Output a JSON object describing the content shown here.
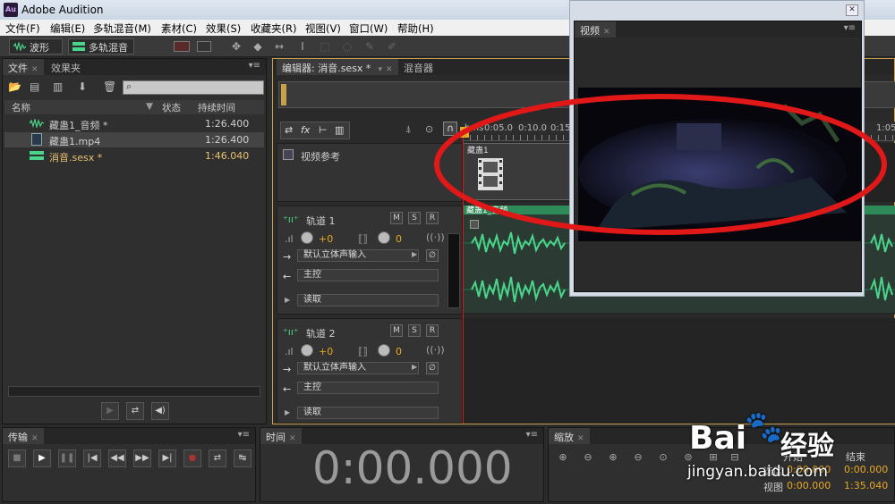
{
  "window": {
    "title": "Adobe Audition",
    "logo": "Au"
  },
  "menu": [
    "文件(F)",
    "编辑(E)",
    "多轨混音(M)",
    "素材(C)",
    "效果(S)",
    "收藏夹(R)",
    "视图(V)",
    "窗口(W)",
    "帮助(H)"
  ],
  "toolbar": {
    "waveform_label": "波形",
    "multitrack_label": "多轨混音"
  },
  "files_panel": {
    "tabs": [
      "文件",
      "效果夹"
    ],
    "columns": {
      "name": "名称",
      "status": "状态",
      "duration": "持续时间"
    },
    "rows": [
      {
        "name": "藏蛊1_音频 *",
        "duration": "1:26.400",
        "icon": "waveform-icon",
        "color": "#4ad68a"
      },
      {
        "name": "藏蛊1.mp4",
        "duration": "1:26.400",
        "icon": "film-icon",
        "color": "#cfcfcf"
      },
      {
        "name": "消音.sesx *",
        "duration": "1:46.040",
        "icon": "session-icon",
        "color": "#e8c070"
      }
    ]
  },
  "editor": {
    "tabs": [
      "编辑器: 消音.sesx *",
      "混音器"
    ],
    "ruler": {
      "unit": "hms",
      "labels": [
        "0:05.0",
        "0:10.0",
        "0:15.",
        "1:05"
      ]
    },
    "video_track": {
      "label": "视频参考",
      "clip_label": "藏蛊1"
    },
    "tracks": [
      {
        "name": "轨道 1",
        "volume": "+0",
        "pan": "0",
        "input": "默认立体声输入",
        "output": "主控",
        "mode": "读取",
        "clip_label": "藏蛊1_音频"
      },
      {
        "name": "轨道 2",
        "volume": "+0",
        "pan": "0",
        "input": "默认立体声输入",
        "output": "主控",
        "mode": "读取"
      }
    ],
    "track_buttons": [
      "M",
      "S",
      "R"
    ]
  },
  "video_panel": {
    "tab": "视频"
  },
  "transport": {
    "tab": "传输"
  },
  "time_panel": {
    "tab": "时间",
    "value": "0:00.000"
  },
  "zoom_panel": {
    "tab": "缩放",
    "selection_label": "选区",
    "view_label": "视图",
    "start_label": "开始",
    "end_label": "结束",
    "selection_start": "0:00.000",
    "selection_end": "0:00.000",
    "view_start": "0:00.000",
    "view_end": "1:35.040"
  },
  "watermark": {
    "brand": "Bai",
    "brand2": "经验",
    "url": "jingyan.baidu.com"
  },
  "colors": {
    "accent": "#c8a14a",
    "waveform": "#4ad68a",
    "annotation": "#e01818",
    "playhead": "#e01818"
  }
}
